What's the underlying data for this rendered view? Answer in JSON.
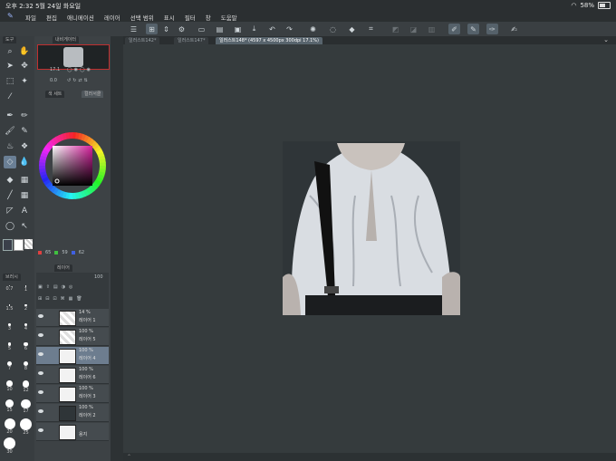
{
  "status": {
    "time": "오후 2:32",
    "date": "5월 24일 화요일",
    "battery": "58%",
    "battery_level": 0.58
  },
  "menu": {
    "items": [
      "파일",
      "편집",
      "애니메이션",
      "레이어",
      "선택 범위",
      "표시",
      "필터",
      "창",
      "도움말"
    ]
  },
  "tabs": [
    {
      "label": "일러스트142*"
    },
    {
      "label": "일러스트147*"
    },
    {
      "label": "일러스트148* (4597 x 4500px 300dpi 17.1%)"
    }
  ],
  "panels": {
    "tool_tab": "도구",
    "navigator_tab": "내비게이터",
    "nav_zoom": "17.1",
    "nav_rotate": "0.0",
    "color_tabs": [
      "색 세트",
      "컬러서클"
    ],
    "color_values": [
      "65",
      "59",
      "62"
    ],
    "layer_tab": "레이어",
    "brush_tab": "브러시",
    "layer_opacity": "100"
  },
  "brush_sizes": [
    "0.7",
    "1",
    "1.5",
    "2",
    "3",
    "4",
    "5",
    "6",
    "7",
    "8",
    "10",
    "12",
    "15",
    "17",
    "20",
    "25",
    "30"
  ],
  "layers": [
    {
      "pct": "14 %",
      "name": "레이어 1",
      "mode": "표"
    },
    {
      "pct": "100 %",
      "name": "레이어 5",
      "mode": "표"
    },
    {
      "pct": "100 %",
      "name": "레이어 4",
      "mode": "표"
    },
    {
      "pct": "100 %",
      "name": "레이어 6",
      "mode": "표"
    },
    {
      "pct": "100 %",
      "name": "레이어 3",
      "mode": "표"
    },
    {
      "pct": "100 %",
      "name": "레이어 2",
      "mode": "표"
    },
    {
      "pct": "",
      "name": "용지",
      "mode": ""
    }
  ],
  "colors": {
    "accent": "#6a7f95",
    "canvas_bg": "#353b3d",
    "fg_color": "#3a3f4a",
    "bg_color": "#ffffff"
  }
}
